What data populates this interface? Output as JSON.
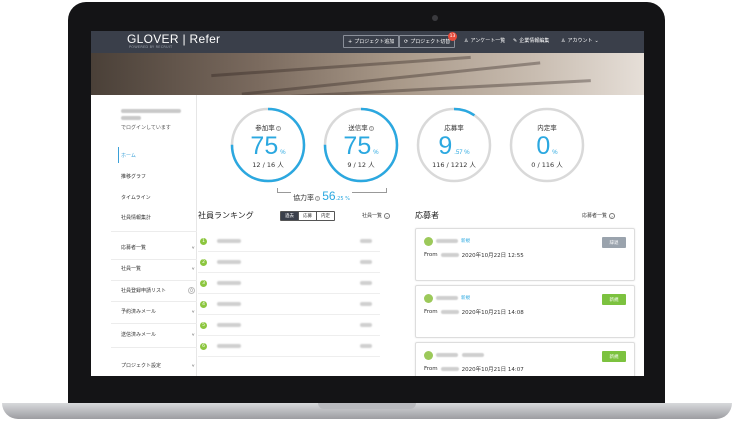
{
  "app": {
    "logo": "GLOVER | Refer",
    "logo_sub": "POWERED BY RECRUIT"
  },
  "nav": {
    "add_project": "プロジェクト追加",
    "switch_project": "プロジェクト切替",
    "switch_badge": "13",
    "survey_list": "アンケート一覧",
    "company_edit": "企業情報編集",
    "account": "アカウント"
  },
  "sidebar": {
    "login_text": "でログインしています",
    "items": [
      {
        "label": "ホーム"
      },
      {
        "label": "推移グラフ"
      },
      {
        "label": "タイムライン"
      },
      {
        "label": "社員情報集計"
      },
      {
        "label": "応募者一覧"
      },
      {
        "label": "社員一覧"
      },
      {
        "label": "社員登録申請リスト",
        "count": "0"
      },
      {
        "label": "予約済みメール"
      },
      {
        "label": "送信済みメール"
      },
      {
        "label": "プロジェクト設定"
      }
    ]
  },
  "stats": [
    {
      "title": "参加率",
      "value": "75",
      "unit": "%",
      "sub": "12 / 16 人",
      "fraction": 0.75,
      "has_help": true
    },
    {
      "title": "送信率",
      "value": "75",
      "unit": "%",
      "sub": "9 / 12 人",
      "fraction": 0.75,
      "has_help": true
    },
    {
      "title": "応募率",
      "value": "9",
      "unit": ".57 %",
      "sub": "116 / 1212 人",
      "fraction": 0.0957,
      "has_help": false
    },
    {
      "title": "内定率",
      "value": "0",
      "unit": "%",
      "sub": "0 / 116 人",
      "fraction": 0.0,
      "has_help": false
    }
  ],
  "cooperation": {
    "label": "協力率",
    "value": "56",
    "unit": ".25 %"
  },
  "ranking": {
    "title": "社員ランキング",
    "tabs": [
      "過去",
      "応募",
      "内定"
    ],
    "more": "社員一覧",
    "ranks": [
      "1",
      "2",
      "3",
      "4",
      "5",
      "6"
    ]
  },
  "applicants": {
    "title": "応募者",
    "more": "応募者一覧",
    "from_label": "From",
    "cards": [
      {
        "tag": "新規",
        "date": "2020年10月22日 12:55",
        "status": "辞退",
        "status_color": "#9aa3ad"
      },
      {
        "tag": "新規",
        "date": "2020年10月21日 14:08",
        "status": "新規",
        "status_color": "#7cc23f"
      },
      {
        "tag": "",
        "date": "2020年10月21日 14:07",
        "status": "新規",
        "status_color": "#7cc23f"
      }
    ]
  },
  "colors": {
    "accent": "#2ba8e0",
    "rank_green": "#8cc63f",
    "topbar": "#3a3f4a"
  }
}
